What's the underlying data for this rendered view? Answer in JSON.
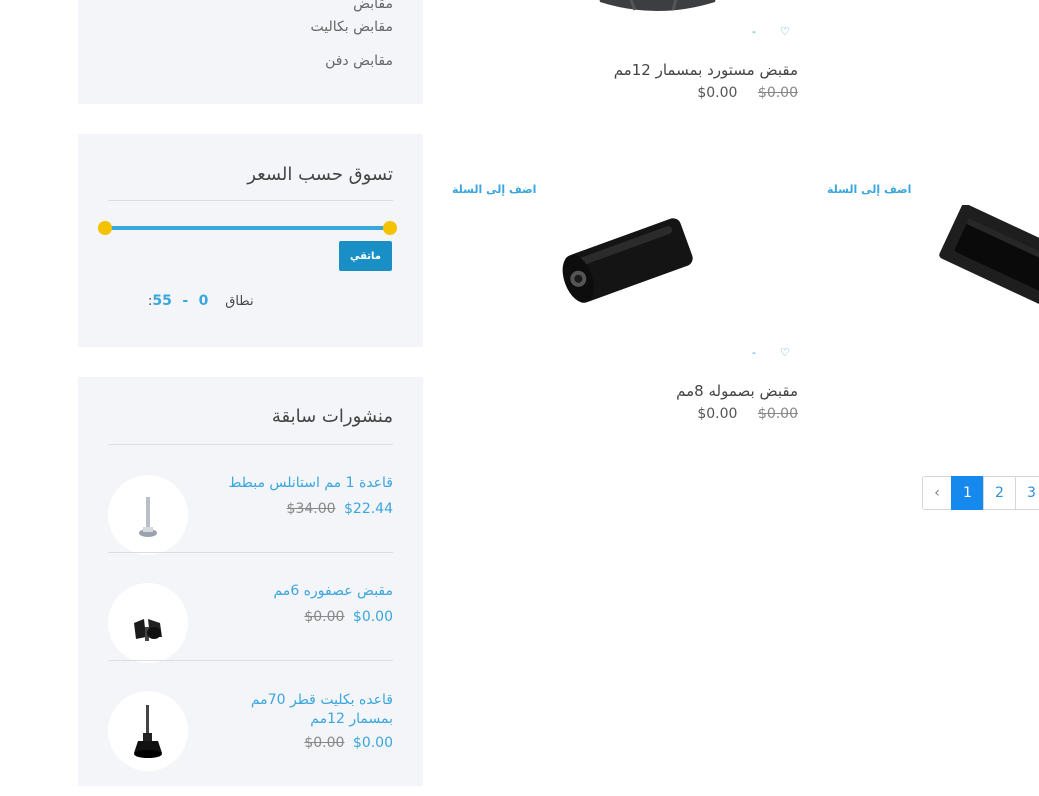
{
  "categories_panel": {
    "items": [
      "مقابض",
      "مقابض بكاليت",
      "مقابض دفن"
    ]
  },
  "price_filter": {
    "title": "تسوق حسب السعر",
    "filter_button": "ماتقي",
    "range_label": ":نطاق",
    "range_min": "0",
    "range_sep": "-",
    "range_max": "55",
    "slider": {
      "min_fraction": 0,
      "max_fraction": 1
    }
  },
  "recent_posts": {
    "title": "منشورات سابقة",
    "items": [
      {
        "title": "قاعدة 1 مم استانلس مبطط",
        "old_price": "$34.00",
        "price": "$22.44"
      },
      {
        "title": "مقبض عصفوره 6مم",
        "old_price": "$0.00",
        "price": "$0.00"
      },
      {
        "title": "قاعده بكليت قطر 70مم بمسمار 12مم",
        "old_price": "$0.00",
        "price": "$0.00"
      }
    ]
  },
  "products": [
    {
      "name": "مقبض مستورد بمسمار 12مم",
      "old_price": "$0.00",
      "price": "$0.00"
    },
    {
      "name": "مقبض بصموله 8مم",
      "old_price": "$0.00",
      "price": "$0.00",
      "add_to_cart": "اضف إلى السلة"
    },
    {
      "add_to_cart": "اضف إلى السلة"
    }
  ],
  "pagination": {
    "prev": "‹",
    "pages": [
      "1",
      "2",
      "3"
    ],
    "active": "1"
  },
  "colors": {
    "accent": "#3aa6de",
    "slider_handle": "#f5c200",
    "active_page": "#1589ee",
    "panel_bg": "#f4f5f9"
  }
}
